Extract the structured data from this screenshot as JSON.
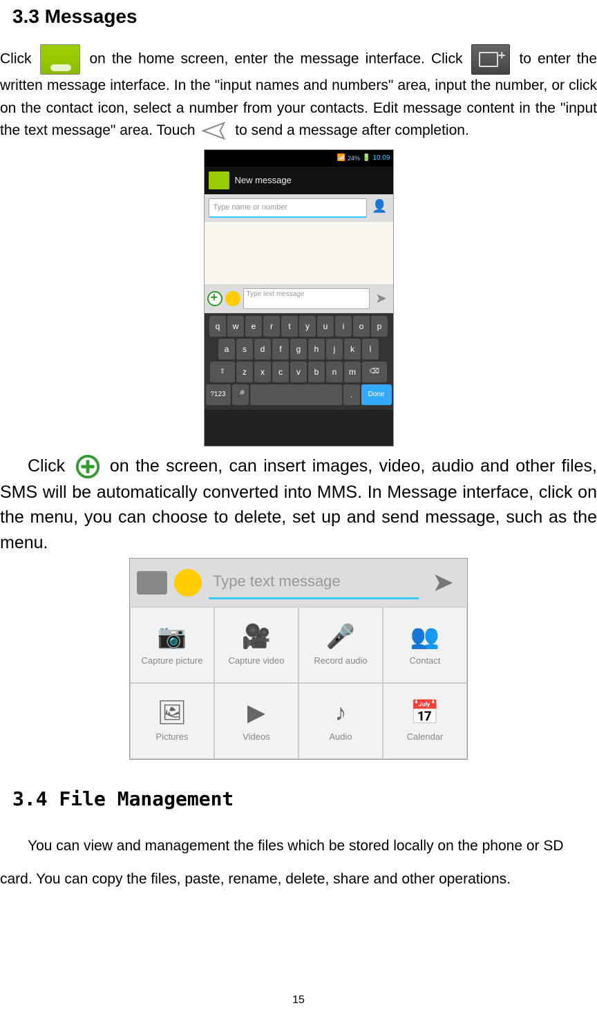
{
  "section33Title": "3.3 Messages",
  "p1a": "Click ",
  "p1b": " on the home screen, enter the message interface. Click ",
  "p1c": " to enter the written message interface. In the \"input names and numbers\" area, input the number, or click on the contact icon, select a number from your contacts. Edit message content in the \"input the text message\" area. Touch ",
  "p1d": " to send a message after completion.",
  "screenshot1": {
    "statusTime": "10:09",
    "statusBattery": "24%",
    "newMessageLabel": "New message",
    "recipientPlaceholder": "Type name or number",
    "textPlaceholder": "Type text message",
    "keyRows": [
      [
        "q",
        "w",
        "e",
        "r",
        "t",
        "y",
        "u",
        "i",
        "o",
        "p"
      ],
      [
        "a",
        "s",
        "d",
        "f",
        "g",
        "h",
        "j",
        "k",
        "l"
      ],
      [
        "⇧",
        "z",
        "x",
        "c",
        "v",
        "b",
        "n",
        "m",
        "⌫"
      ]
    ],
    "bottomRow": {
      "symKey": "?123",
      "micKey": "🎤",
      "doneKey": "Done"
    }
  },
  "p2a": "Click ",
  "p2b": " on the screen, can insert images, video, audio and other files, SMS will be automatically converted into MMS. In Message interface, click on the menu, you can choose to delete, set up and send message, such as the menu.",
  "screenshot2": {
    "textPlaceholder": "Type text message",
    "cells": [
      {
        "label": "Capture picture",
        "glyph": "📷"
      },
      {
        "label": "Capture video",
        "glyph": "🎥"
      },
      {
        "label": "Record audio",
        "glyph": "🎤"
      },
      {
        "label": "Contact",
        "glyph": "👥"
      },
      {
        "label": "Pictures",
        "glyph": "🖼"
      },
      {
        "label": "Videos",
        "glyph": "▶"
      },
      {
        "label": "Audio",
        "glyph": "♪"
      },
      {
        "label": "Calendar",
        "glyph": "📅"
      }
    ]
  },
  "section34Title": "3.4 File Management",
  "p3": "You can view and management the files which be stored locally on the phone or SD card. You can copy the files, paste, rename, delete, share and other operations.",
  "pageNumber": "15"
}
